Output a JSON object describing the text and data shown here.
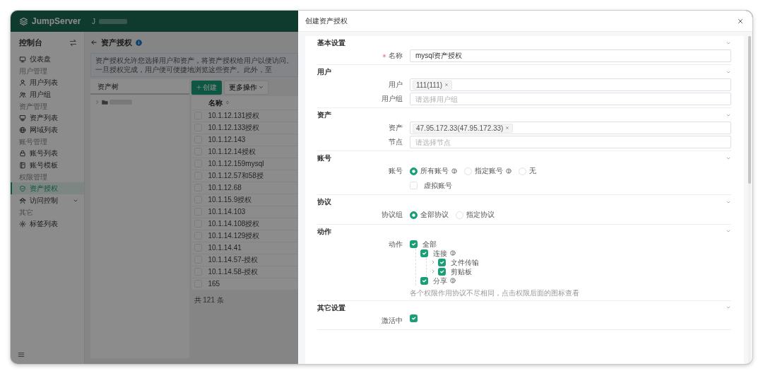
{
  "app": {
    "logo": "JumpServer",
    "org_initial": "J"
  },
  "sidebar": {
    "title": "控制台",
    "groups": [
      {
        "items": [
          {
            "label": "仪表盘",
            "selected": false,
            "expandable": false
          }
        ]
      },
      {
        "heading": "用户管理",
        "items": [
          {
            "label": "用户列表",
            "selected": false,
            "expandable": false
          },
          {
            "label": "用户组",
            "selected": false,
            "expandable": false
          }
        ]
      },
      {
        "heading": "资产管理",
        "items": [
          {
            "label": "资产列表",
            "selected": false,
            "expandable": false
          },
          {
            "label": "网域列表",
            "selected": false,
            "expandable": false
          }
        ]
      },
      {
        "heading": "账号管理",
        "items": [
          {
            "label": "账号列表",
            "selected": false,
            "expandable": false
          },
          {
            "label": "账号模板",
            "selected": false,
            "expandable": false
          }
        ]
      },
      {
        "heading": "权限管理",
        "items": [
          {
            "label": "资产授权",
            "selected": true,
            "expandable": false
          },
          {
            "label": "访问控制",
            "selected": false,
            "expandable": true
          }
        ]
      },
      {
        "heading": "其它",
        "items": [
          {
            "label": "标签列表",
            "selected": false,
            "expandable": false
          }
        ]
      }
    ]
  },
  "page": {
    "title": "资产授权",
    "alert": "资产授权允许您选择用户和资产，将资产授权给用户以便访问。一旦授权完成，用户便可便捷地浏览这些资产。此外，至",
    "tree_tab": "资产树",
    "create_button": "创建",
    "more_button": "更多操作",
    "table": {
      "columns": [
        "名称"
      ],
      "rows": [
        {
          "name": "10.1.12.131授权",
          "selected": false
        },
        {
          "name": "10.1.12.133授权",
          "selected": false
        },
        {
          "name": "10.1.12.143",
          "selected": false
        },
        {
          "name": "10.1.12.14授权",
          "selected": false
        },
        {
          "name": "10.1.12.159mysql",
          "selected": false
        },
        {
          "name": "10.1.12.57和58授",
          "selected": false
        },
        {
          "name": "10.1.12.68",
          "selected": false
        },
        {
          "name": "10.1.15.9授权",
          "selected": false
        },
        {
          "name": "10.1.14.103",
          "selected": false
        },
        {
          "name": "10.1.14.108授权",
          "selected": false
        },
        {
          "name": "10.1.14.129授权",
          "selected": false
        },
        {
          "name": "10.1.14.41",
          "selected": false
        },
        {
          "name": "10.1.14.57-授权",
          "selected": false
        },
        {
          "name": "10.1.14.58-授权",
          "selected": false
        },
        {
          "name": "165",
          "selected": false
        }
      ]
    },
    "total": "共 121 条"
  },
  "drawer": {
    "title": "创建资产授权",
    "sections": [
      {
        "title": "基本设置",
        "fields": [
          {
            "kind": "text",
            "label": "名称",
            "required": true,
            "value": "mysql资产授权"
          }
        ]
      },
      {
        "title": "用户",
        "fields": [
          {
            "kind": "tags",
            "label": "用户",
            "required": false,
            "tags": [
              "111(111)"
            ]
          },
          {
            "kind": "select",
            "label": "用户组",
            "required": false,
            "placeholder": "请选择用户组"
          }
        ]
      },
      {
        "title": "资产",
        "fields": [
          {
            "kind": "tags",
            "label": "资产",
            "required": false,
            "tags": [
              "47.95.172.33(47.95.172.33)"
            ]
          },
          {
            "kind": "select",
            "label": "节点",
            "required": false,
            "placeholder": "请选择节点"
          }
        ]
      },
      {
        "title": "账号",
        "fields": [
          {
            "kind": "radio",
            "label": "账号",
            "required": false,
            "options": [
              {
                "label": "所有账号",
                "help": true,
                "selected": true
              },
              {
                "label": "指定账号",
                "help": true,
                "selected": false
              },
              {
                "label": "无",
                "help": false,
                "selected": false
              }
            ]
          },
          {
            "kind": "checkbox",
            "text": "虚拟账号",
            "checked": false
          }
        ]
      },
      {
        "title": "协议",
        "fields": [
          {
            "kind": "radio",
            "label": "协议组",
            "required": false,
            "options": [
              {
                "label": "全部协议",
                "help": false,
                "selected": true
              },
              {
                "label": "指定协议",
                "help": false,
                "selected": false
              }
            ]
          }
        ]
      },
      {
        "title": "动作",
        "fields": [
          {
            "kind": "tree",
            "label": "动作",
            "required": false,
            "hint": "各个权限作用协议不尽相同，点击权限后面的图标查看",
            "nodes": [
              {
                "label": "全部",
                "checked": true,
                "help": false,
                "expandable": false,
                "children": [
                  {
                    "label": "连接",
                    "checked": true,
                    "help": true,
                    "expandable": false,
                    "children": [
                      {
                        "label": "文件传输",
                        "checked": true,
                        "help": false,
                        "expandable": true
                      },
                      {
                        "label": "剪贴板",
                        "checked": true,
                        "help": false,
                        "expandable": true
                      }
                    ]
                  },
                  {
                    "label": "分享",
                    "checked": true,
                    "help": true,
                    "expandable": false
                  }
                ]
              }
            ]
          }
        ]
      },
      {
        "title": "其它设置",
        "fields": [
          {
            "kind": "check",
            "label": "激活中",
            "required": false,
            "checked": true
          }
        ]
      }
    ]
  }
}
